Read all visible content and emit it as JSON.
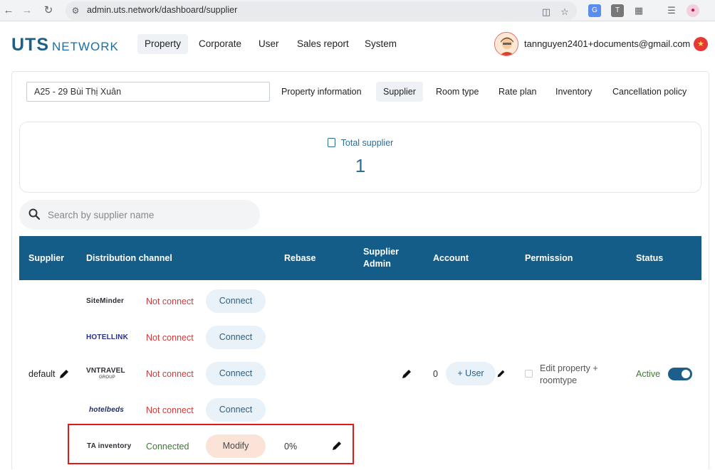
{
  "browser": {
    "url": "admin.uts.network/dashboard/supplier"
  },
  "logo": {
    "main": "UTS",
    "sub": "NETWORK"
  },
  "topnav": [
    {
      "label": "Property",
      "active": true
    },
    {
      "label": "Corporate",
      "active": false
    },
    {
      "label": "User",
      "active": false
    },
    {
      "label": "Sales report",
      "active": false
    },
    {
      "label": "System",
      "active": false
    }
  ],
  "user": {
    "email": "tannguyen2401+documents@gmail.com"
  },
  "property": {
    "selected": "A25 - 29 Bùi Thị Xuân"
  },
  "subtabs": [
    {
      "label": "Property information",
      "active": false
    },
    {
      "label": "Supplier",
      "active": true
    },
    {
      "label": "Room type",
      "active": false
    },
    {
      "label": "Rate plan",
      "active": false
    },
    {
      "label": "Inventory",
      "active": false
    },
    {
      "label": "Cancellation policy",
      "active": false
    }
  ],
  "summary": {
    "label": "Total supplier",
    "value": "1"
  },
  "search": {
    "placeholder": "Search by supplier name"
  },
  "table": {
    "headers": {
      "supplier": "Supplier",
      "channel": "Distribution channel",
      "rebase": "Rebase",
      "admin_line1": "Supplier",
      "admin_line2": "Admin",
      "account": "Account",
      "permission": "Permission",
      "status": "Status"
    },
    "row": {
      "supplier": "default",
      "account_count": "0",
      "account_button": "+ User",
      "permission_line1": "Edit property +",
      "permission_line2": "roomtype",
      "status": "Active",
      "channels": [
        {
          "brand": "SiteMinder",
          "status": "Not connect",
          "action": "Connect"
        },
        {
          "brand": "HOTELLINK",
          "status": "Not connect",
          "action": "Connect"
        },
        {
          "brand": "VNTRAVEL",
          "brand_sub": "GROUP",
          "status": "Not connect",
          "action": "Connect"
        },
        {
          "brand": "hotelbeds",
          "status": "Not connect",
          "action": "Connect"
        },
        {
          "brand": "TA inventory",
          "status": "Connected",
          "action": "Modify",
          "rebase": "0%"
        }
      ]
    }
  },
  "colors": {
    "header_bg": "#155d89",
    "brand": "#1d5f8a",
    "not_connect": "#d23a3a",
    "connected": "#3d7a2f",
    "highlight": "#e01a1a"
  }
}
